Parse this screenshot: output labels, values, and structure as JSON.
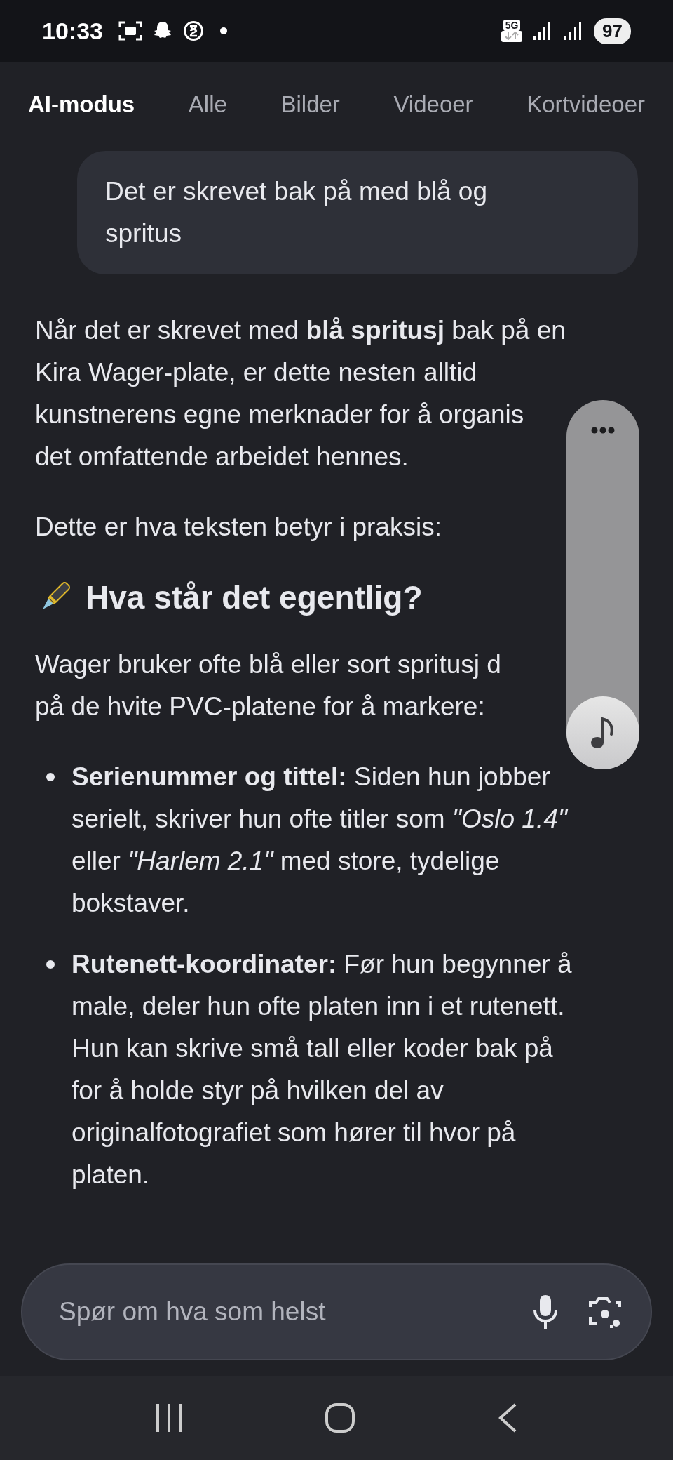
{
  "status_bar": {
    "time": "10:33",
    "network": "5G",
    "battery": "97"
  },
  "tabs": [
    {
      "label": "AI-modus",
      "selected": true
    },
    {
      "label": "Alle",
      "selected": false
    },
    {
      "label": "Bilder",
      "selected": false
    },
    {
      "label": "Videoer",
      "selected": false
    },
    {
      "label": "Kortvideoer",
      "selected": false
    }
  ],
  "user_message": {
    "lines": [
      "Det er skrevet bak på med blå og",
      "spritus"
    ]
  },
  "answer": {
    "blocks": [
      {
        "kind": "paragraph",
        "lines": [
          "Når det er skrevet med **blå spritusj** bak på en",
          "Kira Wager-plate, er dette nesten alltid",
          "kunstnerens egne merknader for å organis",
          "det omfattende arbeidet hennes."
        ]
      },
      {
        "kind": "paragraph",
        "lines": [
          "Dette er hva teksten betyr i praksis:"
        ]
      },
      {
        "kind": "heading",
        "text": "Hva står det egentlig?"
      },
      {
        "kind": "paragraph",
        "lines": [
          "Wager bruker ofte blå eller sort spritusj d",
          "på de hvite PVC-platene for å markere:"
        ]
      },
      {
        "kind": "bullet",
        "lines": [
          "**Serienummer og tittel:** Siden hun jobber",
          "serielt, skriver hun ofte titler som *\"Oslo 1.4\"*",
          "eller *\"Harlem 2.1\"* med store, tydelige",
          "bokstaver."
        ]
      },
      {
        "kind": "bullet",
        "lines": [
          "**Rutenett-koordinater:** Før hun begynner å",
          "male, deler hun ofte platen inn i et rutenett.",
          "Hun kan skrive små tall eller koder bak på",
          "for å holde styr på hvilken del av",
          "originalfotografiet som hører til hvor på",
          "platen."
        ]
      }
    ]
  },
  "input": {
    "placeholder": "Spør om hva som helst"
  }
}
